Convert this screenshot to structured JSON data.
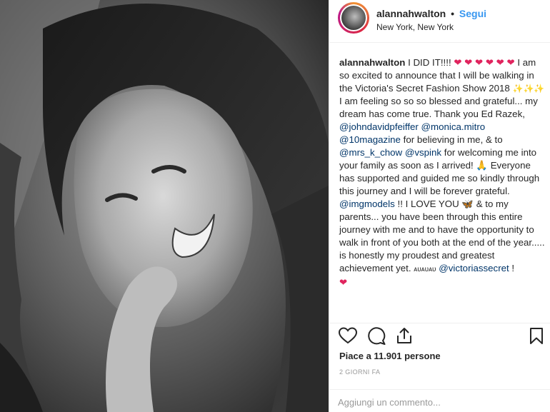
{
  "post": {
    "username": "alannahwalton",
    "dot": "•",
    "follow_label": "Segui",
    "location": "New York, New York"
  },
  "caption": {
    "username": "alannahwalton",
    "t1": "I DID IT!!!!",
    "hearts1": "❤ ❤ ❤ ❤ ❤",
    "heart2": "❤",
    "t2": "I am so excited to announce that I will be walking in the Victoria's Secret Fashion Show 2018",
    "sparkles": "✨✨✨",
    "t3": "I am feeling so so so blessed and grateful... my dream has come true. Thank you Ed Razek,",
    "m1": "@johndavidpfeiffer",
    "m2": "@monica.mitro",
    "m3": "@10magazine",
    "t4": "for believing in me, & to",
    "m4": "@mrs_k_chow",
    "m5": "@vspink",
    "t5": "for welcoming me into your family as soon as I arrived!",
    "pray": "🙏",
    "t6": "Everyone has supported and guided me so kindly through this journey and I will be forever grateful.",
    "m6": "@imgmodels",
    "t7": "!! I LOVE YOU",
    "butterfly": "🦋",
    "t8": "& to my parents... you have been through this entire journey with me and to have the opportunity to walk in front of you both at the end of the year..... is honestly my proudest and greatest achievement yet.",
    "t9": "ᴀᴜᴀᴜᴀᴜ",
    "m7": "@victoriassecret",
    "t10": "!",
    "heart3": "❤"
  },
  "actions": {
    "like_icon": "heart-outline-icon",
    "comment_icon": "comment-icon",
    "share_icon": "share-icon",
    "save_icon": "bookmark-icon"
  },
  "likes_text": "Piace a 11.901 persone",
  "time_ago": "2 GIORNI FA",
  "comment": {
    "placeholder": "Aggiungi un commento...",
    "value": ""
  },
  "colors": {
    "link": "#3897f0",
    "mention": "#003569",
    "heart": "#e0245e",
    "muted": "#999999"
  }
}
